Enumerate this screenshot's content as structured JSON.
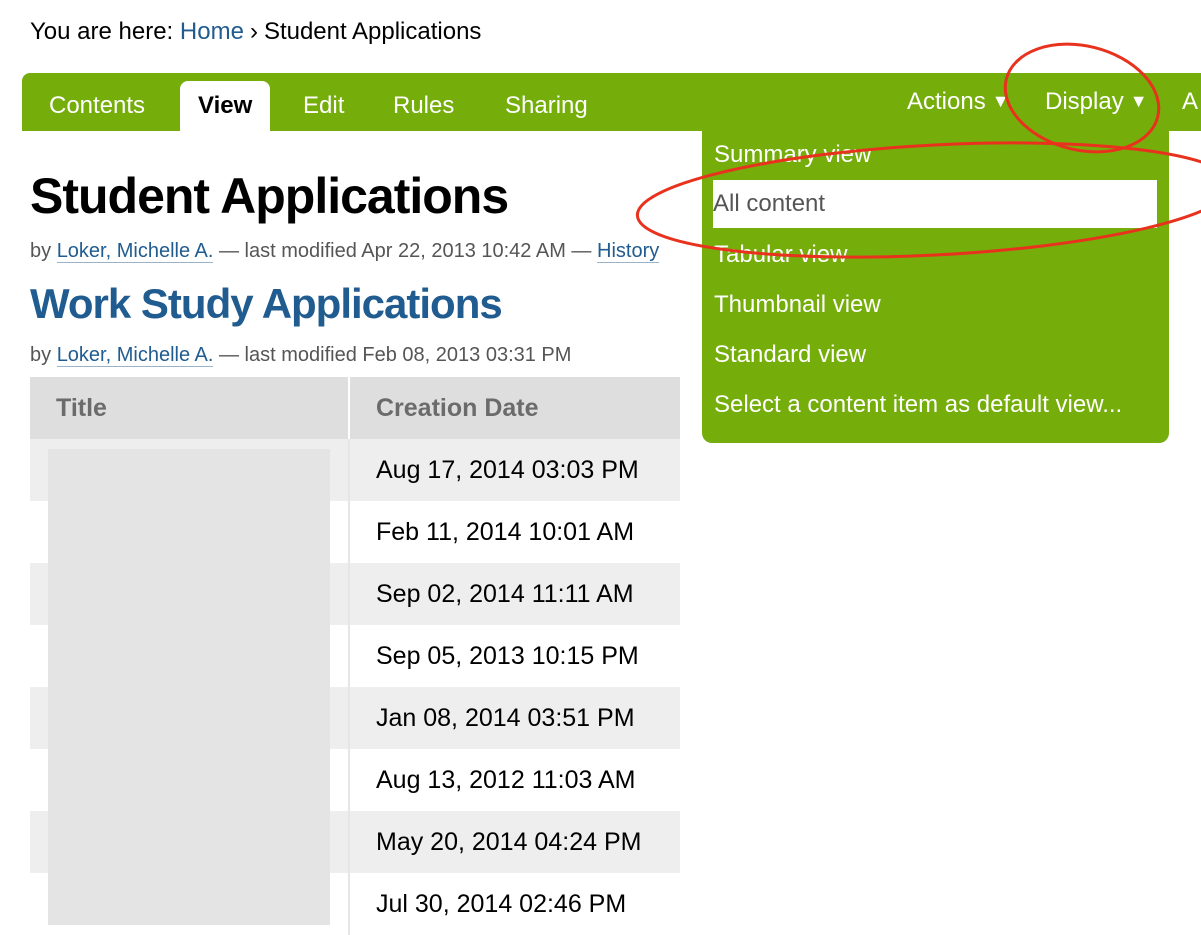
{
  "breadcrumb": {
    "prefix": "You are here:",
    "home": "Home",
    "separator": "›",
    "current": "Student Applications"
  },
  "nav": {
    "tabs": [
      "Contents",
      "View",
      "Edit",
      "Rules",
      "Sharing"
    ],
    "active_tab": "View",
    "actions_label": "Actions",
    "display_label": "Display",
    "cut_off_label": "A",
    "dropdown_arrow": "▼"
  },
  "page": {
    "title": "Student Applications",
    "byline": {
      "by": "by",
      "author": "Loker, Michelle A.",
      "modified": "— last modified Apr 22, 2013 10:42 AM —",
      "history": "History"
    }
  },
  "collection": {
    "title": "Work Study Applications",
    "byline": {
      "by": "by",
      "author": "Loker, Michelle A.",
      "modified": "— last modified Feb 08, 2013 03:31 PM"
    }
  },
  "table": {
    "headers": [
      "Title",
      "Creation Date"
    ],
    "rows": [
      "Aug 17, 2014 03:03 PM",
      "Feb 11, 2014 10:01 AM",
      "Sep 02, 2014 11:11 AM",
      "Sep 05, 2013 10:15 PM",
      "Jan 08, 2014 03:51 PM",
      "Aug 13, 2012 11:03 AM",
      "May 20, 2014 04:24 PM",
      "Jul 30, 2014 02:46 PM"
    ]
  },
  "display_menu": {
    "items": [
      "Summary view",
      "All content",
      "Tabular view",
      "Thumbnail view",
      "Standard view",
      "Select a content item as default view..."
    ],
    "selected": "All content"
  },
  "colors": {
    "nav_green": "#75ad0a",
    "link_blue": "#205c90",
    "annotation_red": "#e8321e"
  }
}
